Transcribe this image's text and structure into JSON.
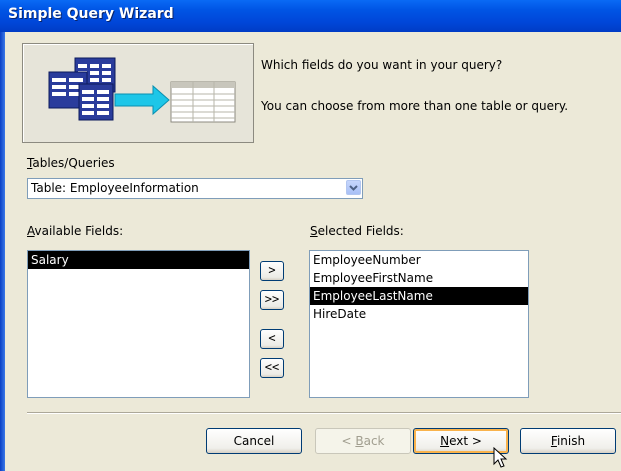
{
  "window": {
    "title": "Simple Query Wizard"
  },
  "prompt": {
    "line1": "Which fields do you want in your query?",
    "line2": "You can choose from more than one table or query."
  },
  "tables_queries": {
    "label_accel": "T",
    "label_rest": "ables/Queries",
    "selected": "Table: EmployeeInformation"
  },
  "available_fields": {
    "label_accel": "A",
    "label_rest": "vailable Fields:",
    "items": [
      "Salary"
    ],
    "selected_index": 0
  },
  "selected_fields": {
    "label_accel": "S",
    "label_rest": "elected Fields:",
    "items": [
      "EmployeeNumber",
      "EmployeeFirstName",
      "EmployeeLastName",
      "HireDate"
    ],
    "selected_index": 2
  },
  "move_buttons": {
    "add_one": ">",
    "add_all": ">>",
    "remove_one": "<",
    "remove_all": "<<"
  },
  "buttons": {
    "cancel": "Cancel",
    "back_pre": "< ",
    "back_accel": "B",
    "back_rest": "ack",
    "next_accel": "N",
    "next_rest": "ext >",
    "finish_accel": "F",
    "finish_rest": "inish"
  },
  "colors": {
    "title_bar": "#0054e3",
    "dialog_bg": "#ece9d8",
    "selection_bg": "#000000"
  }
}
